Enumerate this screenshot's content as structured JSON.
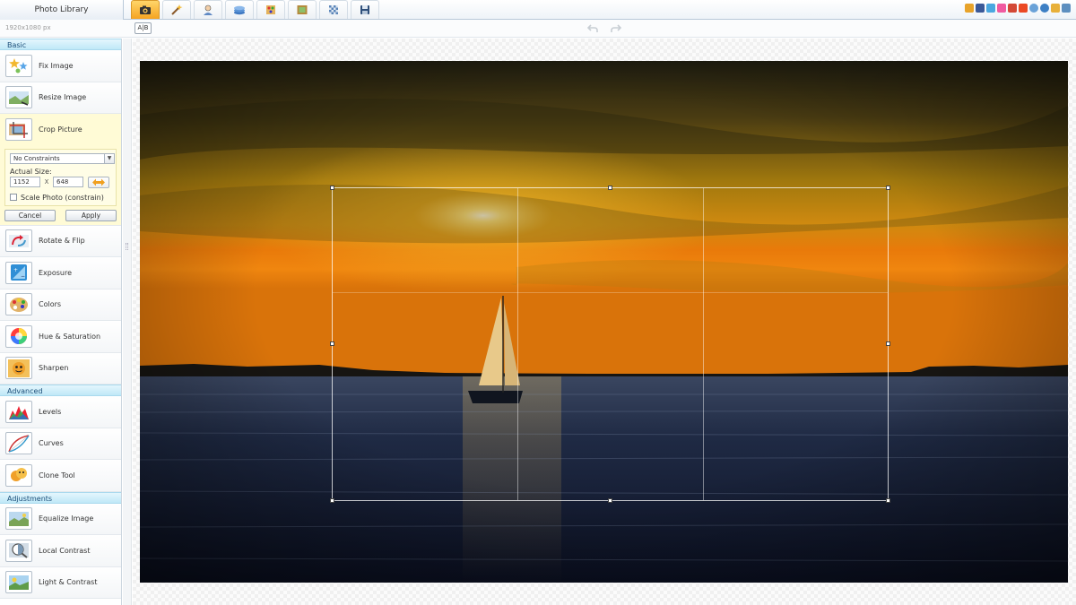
{
  "topbar": {
    "photo_library_label": "Photo Library",
    "tabs": [
      {
        "icon": "camera-icon",
        "active": true
      },
      {
        "icon": "magic-wand-icon",
        "active": false
      },
      {
        "icon": "portrait-icon",
        "active": false
      },
      {
        "icon": "layers-icon",
        "active": false
      },
      {
        "icon": "palette-icon",
        "active": false
      },
      {
        "icon": "frame-icon",
        "active": false
      },
      {
        "icon": "texture-icon",
        "active": false
      },
      {
        "icon": "save-icon",
        "active": false
      }
    ],
    "social_icons": [
      {
        "icon": "home-icon",
        "color": "#e8a32a"
      },
      {
        "icon": "facebook-icon",
        "color": "#3b5998"
      },
      {
        "icon": "twitter-icon",
        "color": "#4aa7e0"
      },
      {
        "icon": "flickr-icon",
        "color": "#f05aa0"
      },
      {
        "icon": "google-plus-icon",
        "color": "#d34836"
      },
      {
        "icon": "stumbleupon-icon",
        "color": "#eb4924"
      },
      {
        "icon": "help-icon",
        "color": "#6aa2d8"
      },
      {
        "icon": "globe-icon",
        "color": "#3d7fc4"
      },
      {
        "icon": "email-icon",
        "color": "#e8b03a"
      },
      {
        "icon": "fullscreen-icon",
        "color": "#5d8fc0"
      }
    ]
  },
  "subbar": {
    "dims_label": "1920x1080 px",
    "ab_label": "A|B"
  },
  "left_panel": {
    "sections": {
      "basic": "Basic",
      "advanced": "Advanced",
      "adjustments": "Adjustments"
    },
    "basic_tools": [
      {
        "label": "Fix Image",
        "icon": "fix-image-icon"
      },
      {
        "label": "Resize Image",
        "icon": "resize-image-icon"
      },
      {
        "label": "Crop Picture",
        "icon": "crop-picture-icon"
      }
    ],
    "basic_tools_after": [
      {
        "label": "Rotate & Flip",
        "icon": "rotate-flip-icon"
      },
      {
        "label": "Exposure",
        "icon": "exposure-icon"
      },
      {
        "label": "Colors",
        "icon": "colors-icon"
      },
      {
        "label": "Hue & Saturation",
        "icon": "hue-saturation-icon"
      },
      {
        "label": "Sharpen",
        "icon": "sharpen-icon"
      }
    ],
    "advanced_tools": [
      {
        "label": "Levels",
        "icon": "levels-icon"
      },
      {
        "label": "Curves",
        "icon": "curves-icon"
      },
      {
        "label": "Clone Tool",
        "icon": "clone-tool-icon"
      }
    ],
    "adjustment_tools": [
      {
        "label": "Equalize Image",
        "icon": "equalize-image-icon"
      },
      {
        "label": "Local Contrast",
        "icon": "local-contrast-icon"
      },
      {
        "label": "Light & Contrast",
        "icon": "light-contrast-icon"
      }
    ],
    "crop": {
      "constraint": "No Constraints",
      "actual_size_label": "Actual Size:",
      "width": "1152",
      "x_sep": "X",
      "height": "648",
      "scale_label": "Scale Photo (constrain)",
      "scale_checked": false,
      "cancel_label": "Cancel",
      "apply_label": "Apply"
    }
  },
  "colors": {
    "active_tab": "#f5a321",
    "section_header": "#bfe8f7",
    "active_tool_bg": "#fffbd6"
  }
}
